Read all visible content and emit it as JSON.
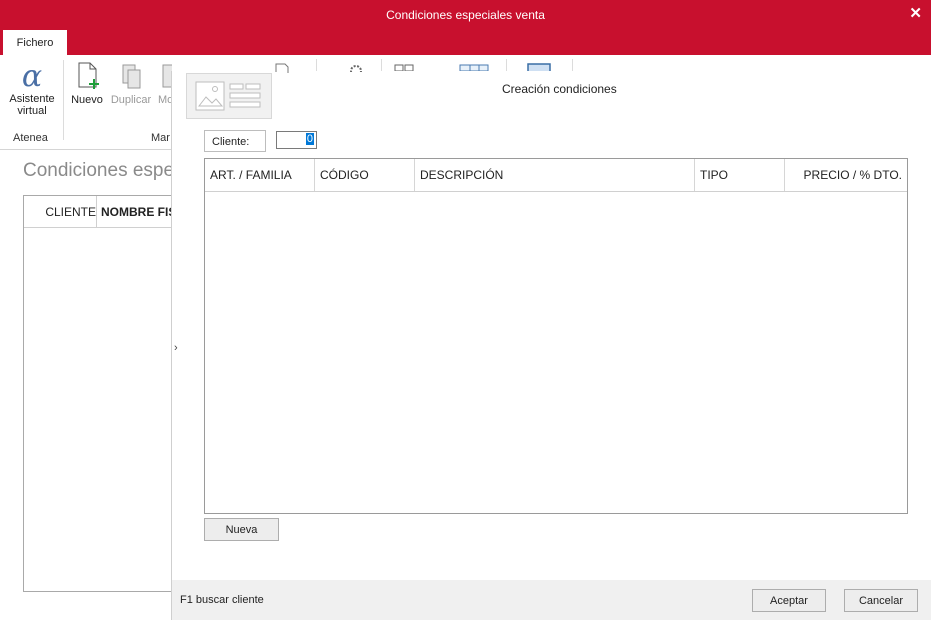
{
  "window": {
    "title": "Condiciones especiales venta",
    "close_glyph": "✕"
  },
  "menu": {
    "tab_label": "Fichero"
  },
  "ribbon": {
    "asistente": {
      "line1": "Asistente",
      "line2": "virtual",
      "icon": "alpha-icon"
    },
    "nuevo": {
      "label": "Nuevo",
      "icon": "new-document-icon"
    },
    "duplicar": {
      "label": "Duplicar",
      "icon": "duplicate-icon"
    },
    "partial_label": "Mo",
    "groups": {
      "atenea": "Atenea",
      "mantenimiento_partial": "Mar"
    }
  },
  "background": {
    "page_title": "Condiciones espe",
    "table_headers": [
      "CLIENTE",
      "NOMBRE FIS"
    ]
  },
  "panel": {
    "title": "Creación condiciones",
    "cliente_label": "Cliente:",
    "cliente_value": "0",
    "collapse_glyph": "›",
    "grid_headers": [
      "ART. / FAMILIA",
      "CÓDIGO",
      "DESCRIPCIÓN",
      "TIPO",
      "PRECIO / % DTO."
    ],
    "nueva_label": "Nueva"
  },
  "footer": {
    "hint": "F1 buscar cliente",
    "accept_label": "Aceptar",
    "cancel_label": "Cancelar"
  },
  "colors": {
    "brand": "#c8102e",
    "alpha": "#4a6fa5",
    "plus": "#1f9e3a"
  }
}
